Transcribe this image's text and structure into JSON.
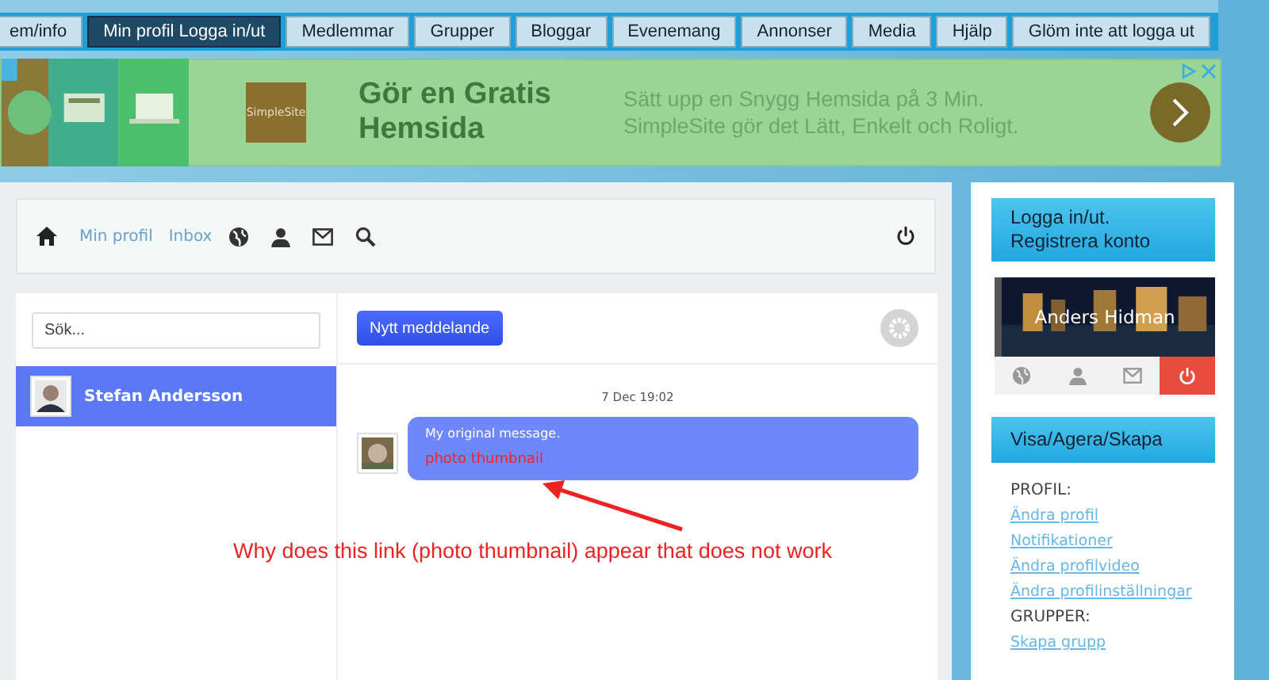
{
  "nav_tabs": [
    {
      "label": "em/info",
      "selected": false
    },
    {
      "label": "Min profil Logga in/ut",
      "selected": true
    },
    {
      "label": "Medlemmar",
      "selected": false
    },
    {
      "label": "Grupper",
      "selected": false
    },
    {
      "label": "Bloggar",
      "selected": false
    },
    {
      "label": "Evenemang",
      "selected": false
    },
    {
      "label": "Annonser",
      "selected": false
    },
    {
      "label": "Media",
      "selected": false
    },
    {
      "label": "Hjälp",
      "selected": false
    },
    {
      "label": "Glöm inte att logga ut",
      "selected": false
    }
  ],
  "ad": {
    "logo": "SimpleSite",
    "headline": "Gör en Gratis Hemsida",
    "lines": [
      "Sätt upp en Snygg Hemsida på 3 Min.",
      "SimpleSite gör det Lätt, Enkelt och Roligt."
    ]
  },
  "toolbar": {
    "links": [
      "Min profil",
      "Inbox"
    ]
  },
  "search": {
    "placeholder": "Sök..."
  },
  "contacts": [
    {
      "name": "Stefan Andersson",
      "selected": true
    }
  ],
  "new_message_button": "Nytt meddelande",
  "messages": [
    {
      "time": "7 Dec 19:02",
      "text": "My original message.",
      "link": "photo thumbnail"
    }
  ],
  "annotation": "Why does this link (photo thumbnail) appear that does not work",
  "sidebar": {
    "login_title": "Logga in/ut. Registrera konto",
    "user_name": "Anders Hidman",
    "menu_title": "Visa/Agera/Skapa",
    "items": [
      {
        "kind": "heading",
        "label": "PROFIL:"
      },
      {
        "kind": "link",
        "label": "Ändra profil"
      },
      {
        "kind": "link",
        "label": "Notifikationer"
      },
      {
        "kind": "link",
        "label": "Ändra profilvideo"
      },
      {
        "kind": "link",
        "label": "Ändra profilinställningar"
      },
      {
        "kind": "heading",
        "label": "GRUPPER:"
      },
      {
        "kind": "link",
        "label": "Skapa grupp"
      }
    ]
  }
}
